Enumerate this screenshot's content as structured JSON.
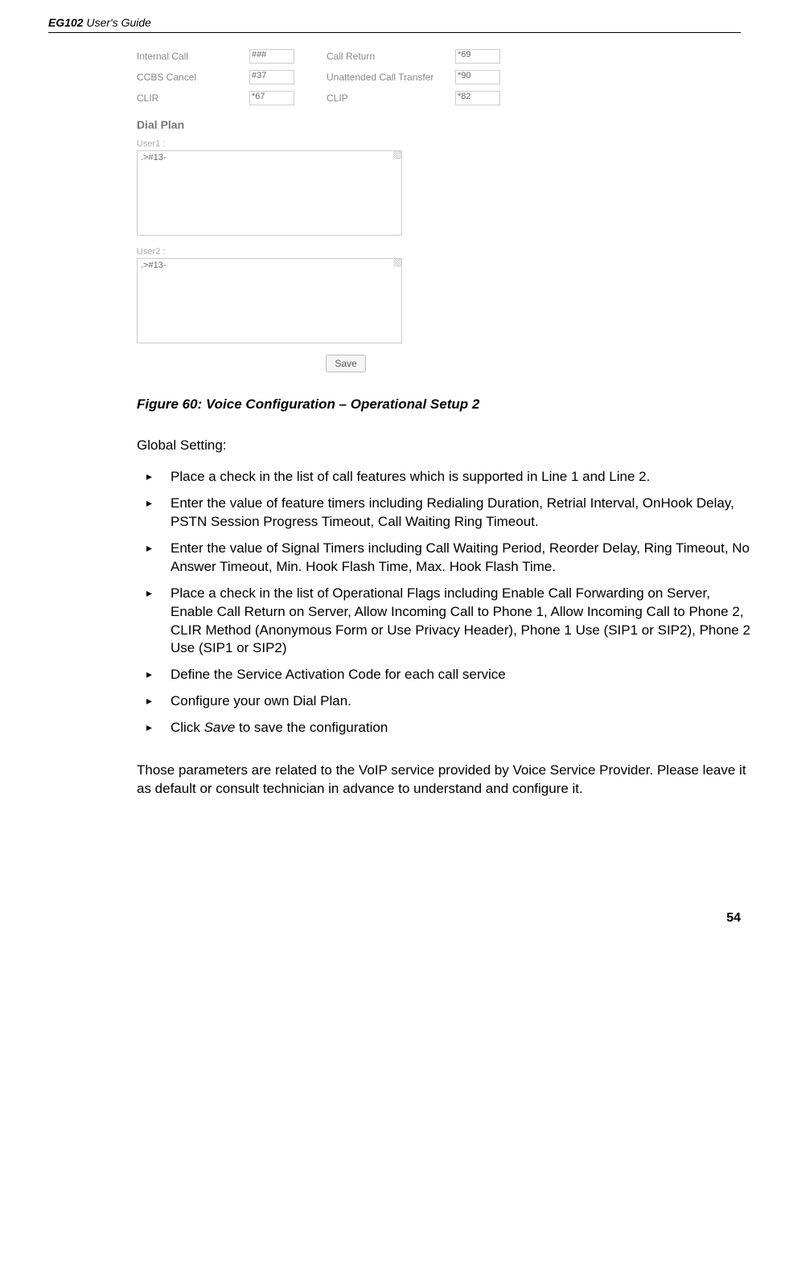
{
  "header": {
    "bold": "EG102",
    "rest": " User's Guide"
  },
  "screenshot": {
    "rows": [
      {
        "l1": "Internal Call",
        "v1": "###",
        "l2": "Call Return",
        "v2": "*69"
      },
      {
        "l1": "CCBS Cancel",
        "v1": "#37",
        "l2": "Unattended Call Transfer",
        "v2": "*90"
      },
      {
        "l1": "CLIR",
        "v1": "*67",
        "l2": "CLIP",
        "v2": "*82"
      }
    ],
    "dialplan_title": "Dial Plan",
    "user1_label": "User1 :",
    "user1_value": ".>#13-",
    "user2_label": "User2 :",
    "user2_value": ".>#13-",
    "save_label": "Save"
  },
  "figure_caption": "Figure 60: Voice Configuration – Operational Setup 2",
  "global_setting": "Global Setting:",
  "bullets": [
    "Place a check in the list of call features which is supported in Line 1 and Line 2.",
    "Enter the value of feature timers including Redialing Duration, Retrial Interval, OnHook Delay, PSTN Session Progress Timeout, Call Waiting Ring Timeout.",
    "Enter the value of Signal Timers including Call Waiting Period, Reorder Delay, Ring Timeout, No Answer Timeout, Min. Hook Flash Time, Max. Hook Flash Time.",
    "Place a check in the list of Operational Flags including Enable Call Forwarding on Server, Enable Call Return on Server, Allow Incoming Call to Phone 1, Allow Incoming Call to Phone 2, CLIR Method (Anonymous Form or Use Privacy Header), Phone 1 Use (SIP1 or SIP2), Phone 2 Use (SIP1 or SIP2)",
    "Define the Service Activation Code for each call service",
    "Configure your own Dial Plan."
  ],
  "bullet_save_prefix": "Click ",
  "bullet_save_italic": "Save",
  "bullet_save_suffix": " to save the configuration",
  "closing": "Those parameters are related to the VoIP service provided by Voice Service Provider. Please leave it as default or consult technician in advance to understand and configure it.",
  "page_number": "54"
}
